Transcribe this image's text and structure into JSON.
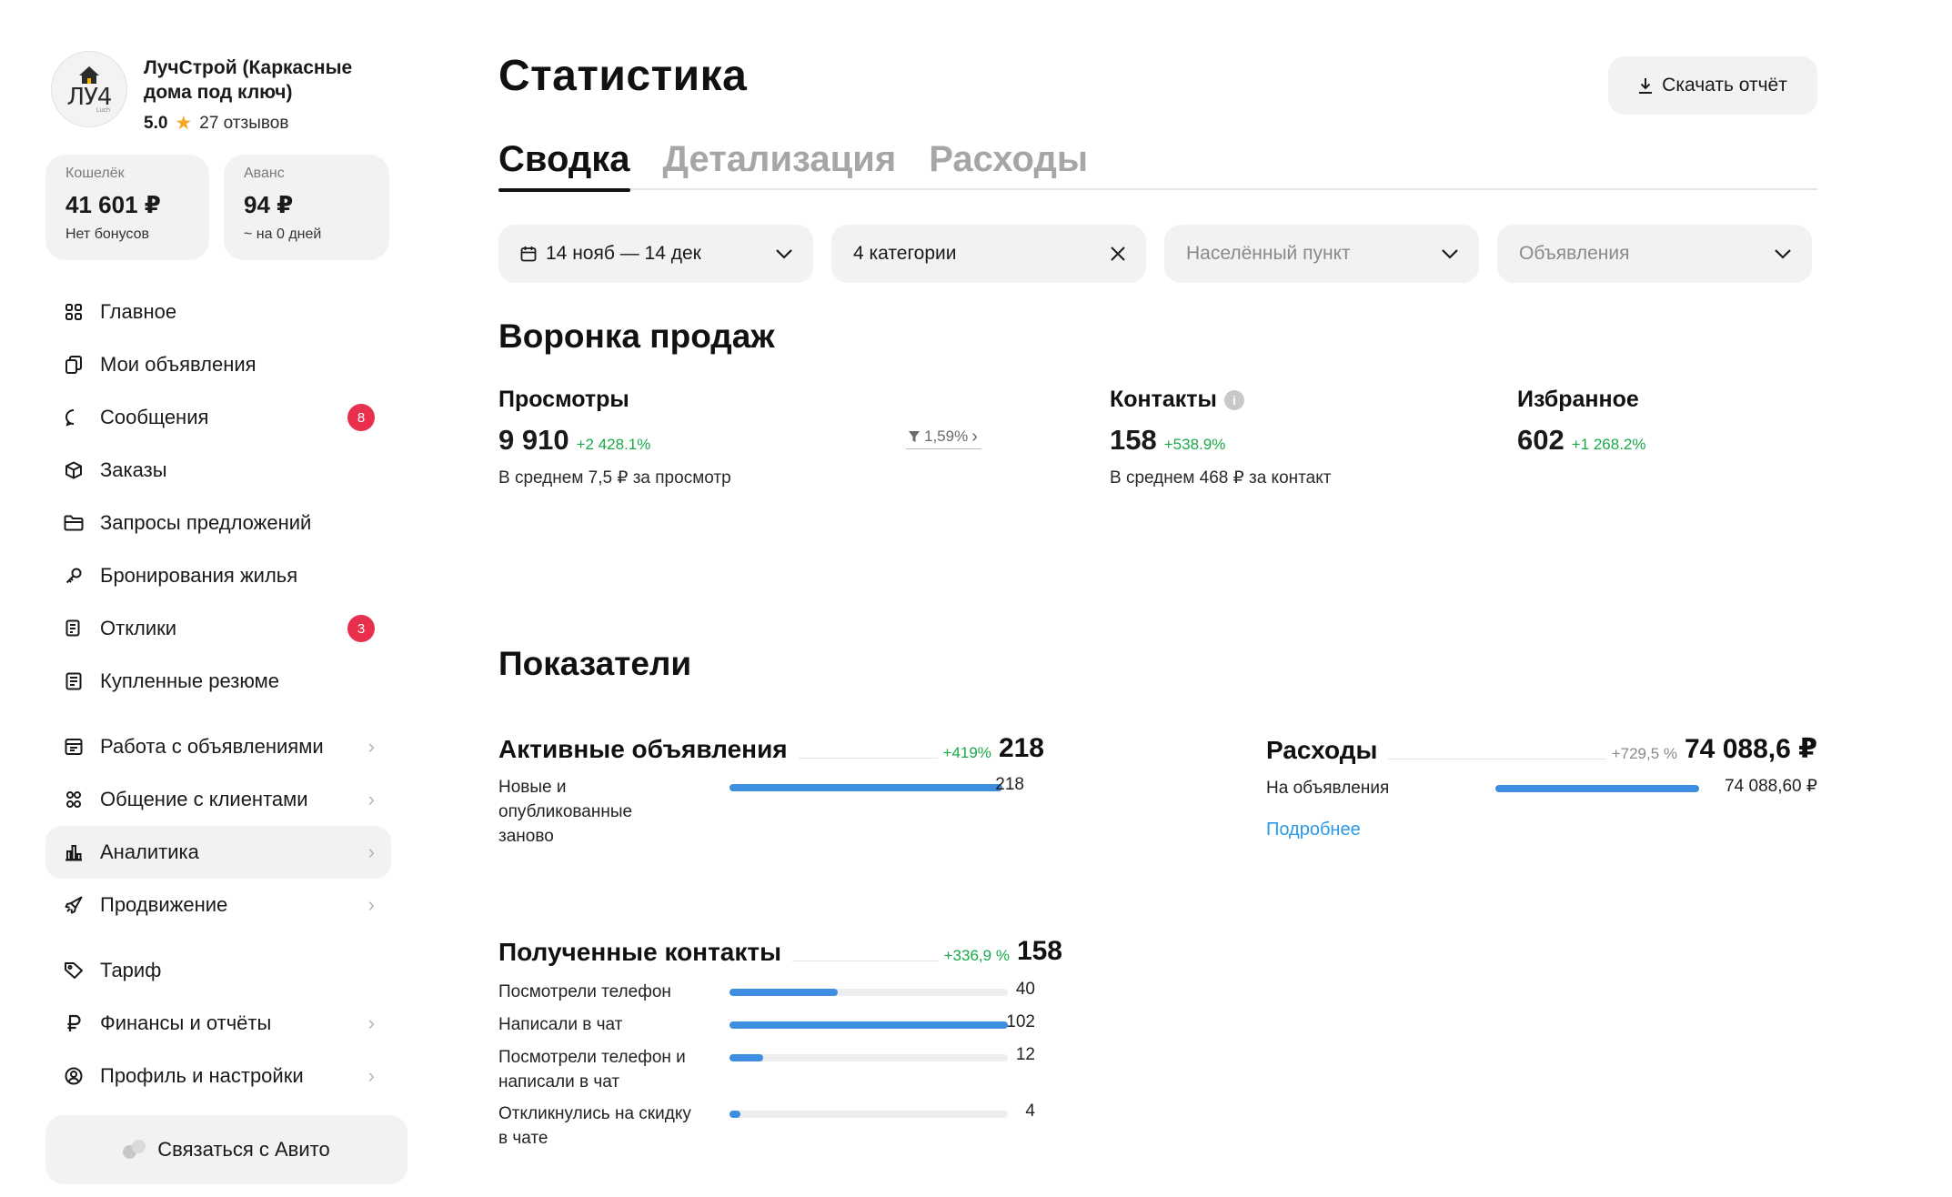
{
  "sidebar": {
    "company_name": "ЛучСтрой (Каркасные дома под ключ)",
    "logo_text": "ЛУ4",
    "logo_small": "Luch",
    "rating": "5.0",
    "reviews": "27 отзывов",
    "wallet": {
      "label": "Кошелёк",
      "value": "41 601 ₽",
      "sub": "Нет бонусов"
    },
    "advance": {
      "label": "Аванс",
      "value": "94 ₽",
      "sub": "~ на 0 дней"
    },
    "nav": [
      {
        "label": "Главное",
        "icon": "grid-icon"
      },
      {
        "label": "Мои объявления",
        "icon": "copy-icon"
      },
      {
        "label": "Сообщения",
        "icon": "chat-icon",
        "badge": "8"
      },
      {
        "label": "Заказы",
        "icon": "box-icon"
      },
      {
        "label": "Запросы предложений",
        "icon": "folder-icon"
      },
      {
        "label": "Бронирования жилья",
        "icon": "key-icon"
      },
      {
        "label": "Отклики",
        "icon": "document-icon",
        "badge": "3"
      },
      {
        "label": "Купленные резюме",
        "icon": "resume-icon"
      },
      {
        "label": "Работа с объявлениями",
        "icon": "ads-icon"
      },
      {
        "label": "Общение с клиентами",
        "icon": "users-icon"
      },
      {
        "label": "Аналитика",
        "icon": "bar-chart-icon"
      },
      {
        "label": "Продвижение",
        "icon": "rocket-icon"
      },
      {
        "label": "Тариф",
        "icon": "tag-icon"
      },
      {
        "label": "Финансы и отчёты",
        "icon": "ruble-icon"
      },
      {
        "label": "Профиль и настройки",
        "icon": "profile-icon"
      }
    ],
    "contact_button": "Связаться с Авито"
  },
  "header": {
    "title": "Статистика",
    "download": "Скачать отчёт"
  },
  "tabs": [
    "Сводка",
    "Детализация",
    "Расходы"
  ],
  "filters": {
    "period": "14 нояб — 14 дек",
    "categories": "4 категории",
    "location_placeholder": "Населённый пункт",
    "ads_placeholder": "Объявления"
  },
  "funnel": {
    "title": "Воронка продаж",
    "views": {
      "label": "Просмотры",
      "value": "9 910",
      "delta": "+2 428.1%",
      "sub": "В среднем 7,5 ₽ за просмотр"
    },
    "conversion": "1,59%",
    "contacts": {
      "label": "Контакты",
      "value": "158",
      "delta": "+538.9%",
      "sub": "В среднем 468 ₽ за контакт"
    },
    "favorites": {
      "label": "Избранное",
      "value": "602",
      "delta": "+1 268.2%"
    }
  },
  "metrics": {
    "title": "Показатели",
    "active_ads": {
      "title": "Активные объявления",
      "delta": "+419%",
      "total": "218",
      "rows": [
        {
          "label": "Новые и опубликованные заново",
          "value": "218",
          "fraction": 1.0
        }
      ]
    },
    "expenses": {
      "title": "Расходы",
      "delta": "+729,5 %",
      "total": "74 088,6 ₽",
      "rows": [
        {
          "label": "На объявления",
          "value": "74 088,60 ₽",
          "fraction": 1.0
        }
      ],
      "link": "Подробнее"
    },
    "contacts": {
      "title": "Полученные контакты",
      "delta": "+336,9 %",
      "total": "158",
      "rows": [
        {
          "label": "Посмотрели телефон",
          "value": "40",
          "fraction": 0.39
        },
        {
          "label": "Написали в чат",
          "value": "102",
          "fraction": 1.0
        },
        {
          "label": "Посмотрели телефон и написали в чат",
          "value": "12",
          "fraction": 0.12
        },
        {
          "label": "Откликнулись на скидку в чате",
          "value": "4",
          "fraction": 0.04
        }
      ]
    }
  },
  "colors": {
    "accent_blue": "#3d8de0",
    "positive_green": "#19a94a",
    "badge_red": "#e8304c",
    "link_blue": "#2b9ae6"
  }
}
